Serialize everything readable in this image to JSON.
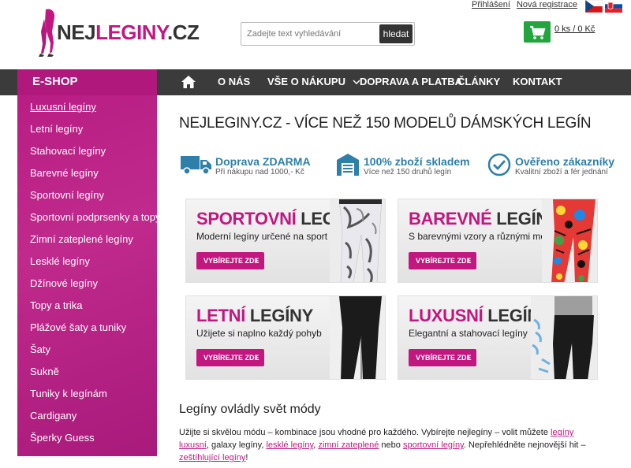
{
  "header": {
    "logo_prefix": "NEJ",
    "logo_main": "LEGINY",
    "logo_suffix": ".CZ",
    "search_placeholder": "Zadejte text vyhledávání",
    "search_button": "hledat",
    "login": "Přihlášení",
    "register": "Nová registrace",
    "cart_text": "0 ks / 0 Kč",
    "brand_color": "#c2177f"
  },
  "nav": {
    "eshop": "E-SHOP",
    "items": [
      "O NÁS",
      "VŠE O NÁKUPU",
      "DOPRAVA A PLATBA",
      "ČLÁNKY",
      "KONTAKT"
    ]
  },
  "sidebar": {
    "items": [
      "Luxusní legíny",
      "Letní legíny",
      "Stahovací legíny",
      "Barevné legíny",
      "Sportovní legíny",
      "Sportovní podprsenky a topy",
      "Zimní zateplené legíny",
      "Lesklé legíny",
      "Džínové legíny",
      "Topy a trika",
      "Plážové šaty a tuniky",
      "Šaty",
      "Sukně",
      "Tuniky k legínám",
      "Cardigany",
      "Šperky Guess"
    ]
  },
  "main": {
    "title": "NEJLEGINY.CZ - VÍCE NEŽ 150 MODELŮ DÁMSKÝCH LEGÍN",
    "features": [
      {
        "title": "Doprava ZDARMA",
        "sub": "Při nákupu nad 1000,- Kč",
        "icon": "truck-icon"
      },
      {
        "title": "100% zboží skladem",
        "sub": "Více než 150 druhů legín",
        "icon": "warehouse-icon"
      },
      {
        "title": "Ověřeno zákazníky",
        "sub": "Kvalitní zboží a fér jednání",
        "icon": "check-circle-icon"
      }
    ],
    "banners": [
      {
        "title_pink": "SPORTOVNÍ",
        "title_dark": "LEGÍNY",
        "sub": "Moderní legíny určené na sport",
        "button": "VYBÍREJTE ZDE"
      },
      {
        "title_pink": "BAREVNÉ",
        "title_dark": "LEGÍNY",
        "sub": "S barevnými vzory a různými motivy",
        "button": "VYBÍREJTE ZDE"
      },
      {
        "title_pink": "LETNÍ",
        "title_dark": "LEGÍNY",
        "sub": "Užijete si naplno každý pohyb",
        "button": "VYBÍREJTE ZDE"
      },
      {
        "title_pink": "LUXUSNÍ",
        "title_dark": "LEGÍNY",
        "sub": "Elegantní a stahovací legíny",
        "button": "VYBÍREJTE ZDE"
      }
    ],
    "section_heading": "Legíny ovládly svět módy",
    "para_1": "Užijte si skvělou módu – kombinace jsou vhodné pro každého. Vybírejte nejlegíny – volit můžete ",
    "link_1": "legíny luxusní",
    "para_2": ", galaxy legíny, ",
    "link_2": "lesklé legíny",
    "para_3": ", ",
    "link_3": "zimní zateplené",
    "para_4": " nebo ",
    "link_4": "sportovní legíny",
    "para_5": ". Nepřehlédněte nejnovější hit – ",
    "link_5": "zeštíhlující legíny",
    "para_6": "!"
  }
}
